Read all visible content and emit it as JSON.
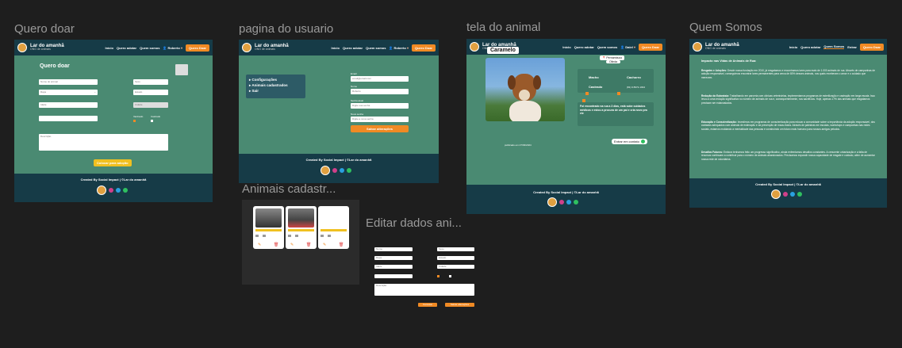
{
  "titles": {
    "quero_doar": "Quero doar",
    "pagina_usuario": "pagina do usuario",
    "tela_animal": "tela do animal",
    "quem_somos": "Quem Somos",
    "animais_cadastrados": "Animais cadastr...",
    "editar_dados": "Editar dados ani..."
  },
  "nav": {
    "brand": "Lar do amanhã",
    "tagline": "ONG de animais",
    "inicio": "Início",
    "quero_adotar": "Quero adotar",
    "quem_somos": "Quem somos",
    "quem_somos_alt": "Quem Somos",
    "entrar": "Entrar",
    "user1": "Roberto",
    "user2": "Daiel",
    "cta": "Quero Doar"
  },
  "footer": {
    "credit": "Created By Social Impact | ©Lar do amanhã"
  },
  "doar": {
    "heading": "Quero doar",
    "fields": [
      "Nome do animal",
      "Raça",
      "Idade",
      "Cidade"
    ],
    "fields_right": [
      "Sexo",
      "Estado"
    ],
    "checkbox1": "Vacinado",
    "checkbox2": "Castrado",
    "description": "Descrição",
    "submit": "Colocar para adoção"
  },
  "usuario": {
    "menu": [
      "Configurações",
      "Animais cadastrados",
      "Sair"
    ],
    "labels": [
      "Email",
      "Nome",
      "Senha atual",
      "Nova senha"
    ],
    "values": [
      "email@email.com",
      "Roberto",
      "Digite sua senha",
      "Digite a nova senha"
    ],
    "submit": "Salvar alterações"
  },
  "animal": {
    "name": "Caramelo",
    "state": "Pernambuco",
    "city": "Olinda",
    "tags": [
      "Macho",
      "Cachorro",
      "Castrado",
      "(81) 9 8972-1934"
    ],
    "description": "Foi encontrado na rua a 3 dias, está sobe cuidados médicos e estou a procura de um pai e cria novo pra ele",
    "posted": "publicado em 27/03/2024",
    "contact": "Entrar em contato"
  },
  "quem": {
    "heading": "Impacto nas Vidas de Animais de Rua:",
    "sections": [
      {
        "title": "Resgates e Adoções:",
        "body": "Desde nossa fundação em 2010, já resgatamos e encontramos lares para mais de 1.000 animais de rua. Através de campanhas de adoção responsável, conseguimos encontrar lares permanentes para cerca de 80% desses animais, nos quais receberam o amor e o cuidado que merecem."
      },
      {
        "title": "Redução da Eutanásia:",
        "body": "Trabalhando em parceria com clínicas veterinárias, implementamos programas de esterilização e castração em larga escala. Isso levou a uma redução significativa no número de animais de rua e, consequentemente, nos sacrifícios. Hoje, apenas 17% dos animais que resgatamos precisam ser eutanasiados."
      },
      {
        "title": "Educação e Conscientização:",
        "body": "Investimos em programas de conscientização para educar a comunidade sobre a importância da adoção responsável, dos cuidados adequados com animais de estimação e da prevenção de maus-tratos. Através de palestras em escolas, workshops e campanhas nas redes sociais, estamos moldando a mentalidade das pessoas e construindo um futuro mais humano para nossos amigos peludos."
      },
      {
        "title": "Desafios Futuros:",
        "body": "Embora tenhamos feito um progresso significativo, ainda enfrentamos desafios constantes. A crescente urbanização e a falta de recursos continuam a contribuir para o número de animais abandonados. Precisamos expandir nossa capacidade de resgate e cuidado, além de aumentar nossa rede de voluntários."
      }
    ]
  },
  "editar": {
    "cancel": "Cancelar",
    "save": "Salvar alterações",
    "fields": [
      "Nome",
      "Raça",
      "Idade",
      "Cidade",
      "Sexo",
      "Estado"
    ],
    "description": "Descrição"
  },
  "colors": {
    "background": "#1e1e1e",
    "green": "#4a8a72",
    "navy": "#163b47",
    "orange": "#f08a24"
  }
}
